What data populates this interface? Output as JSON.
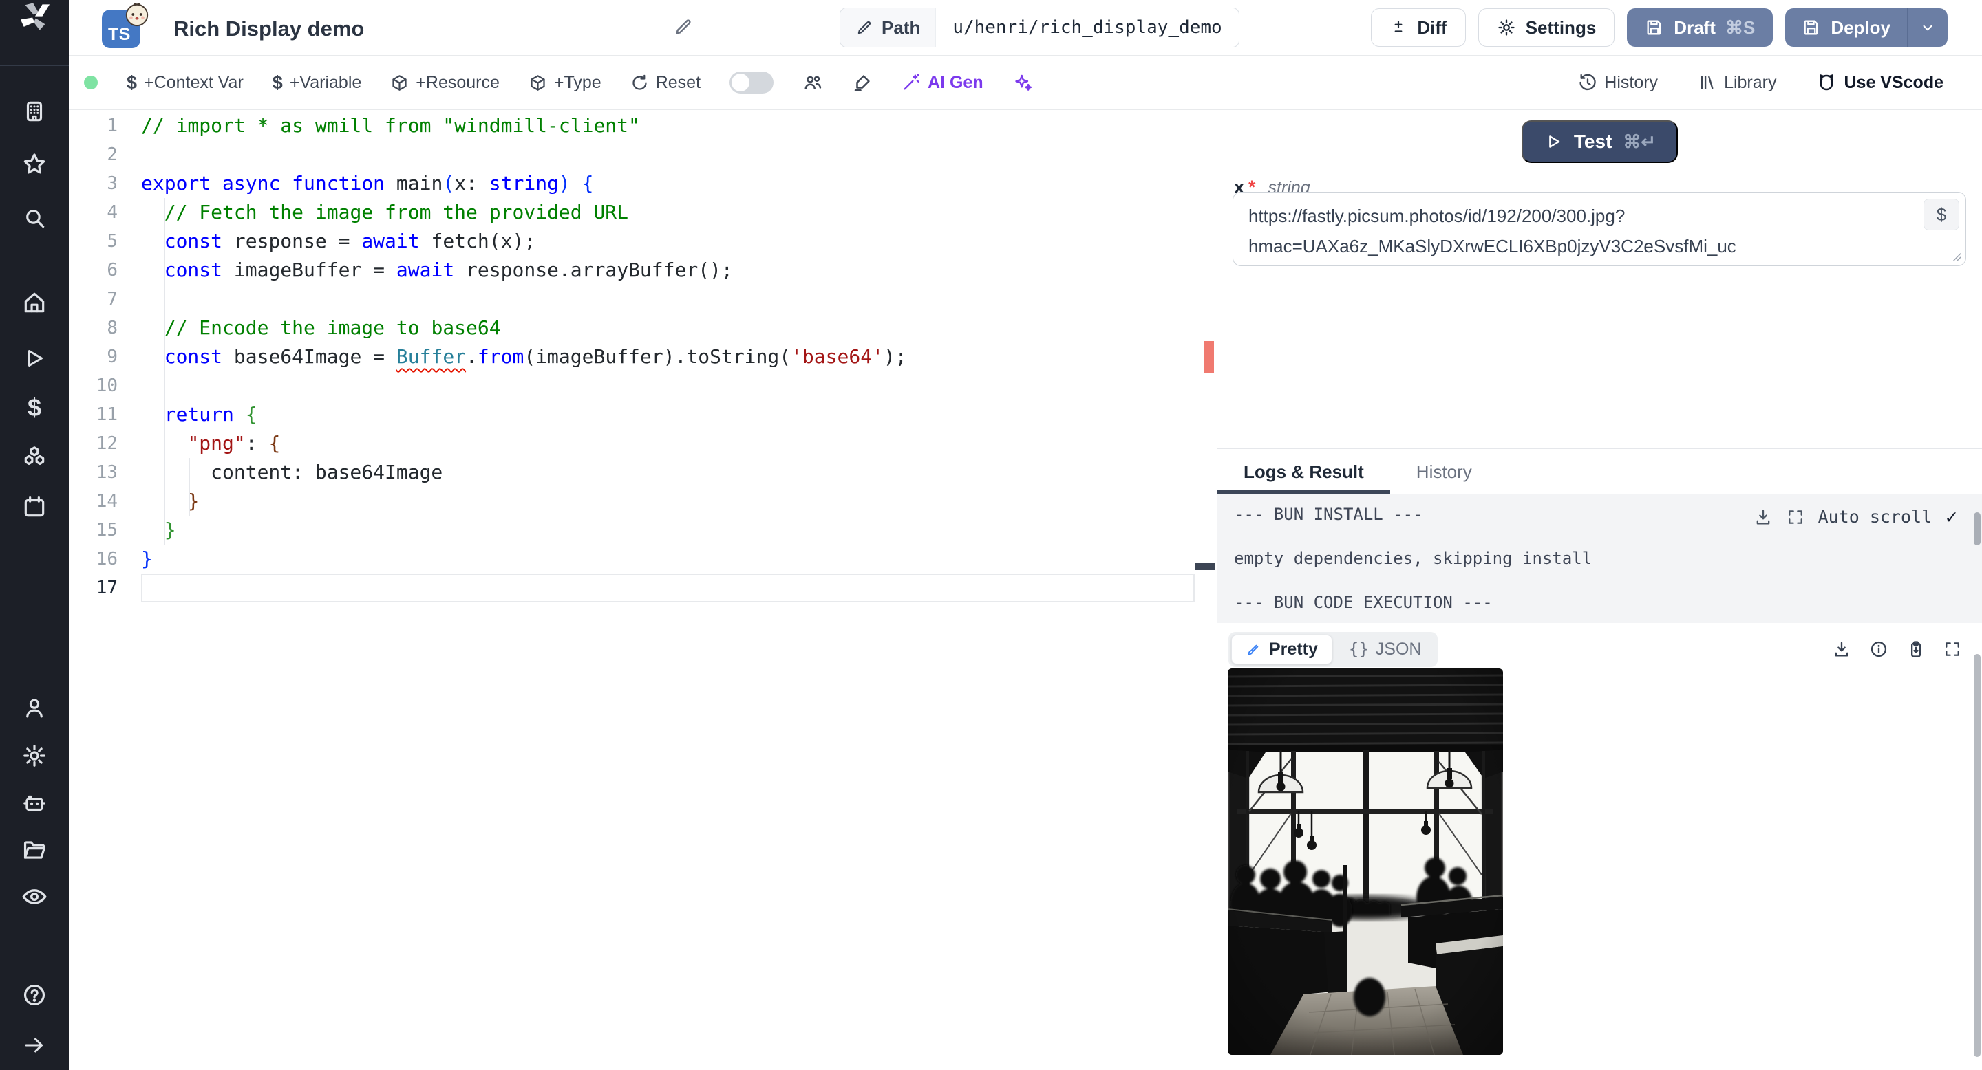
{
  "app": {
    "title": "Rich Display demo",
    "lang_badge": "TS"
  },
  "header": {
    "path_label": "Path",
    "path_value": "u/henri/rich_display_demo",
    "diff": "Diff",
    "settings": "Settings",
    "draft": "Draft",
    "draft_shortcut": "⌘S",
    "deploy": "Deploy"
  },
  "toolbar": {
    "context_var": "+Context Var",
    "variable": "+Variable",
    "resource": "+Resource",
    "type": "+Type",
    "reset": "Reset",
    "ai_gen": "AI Gen",
    "history": "History",
    "library": "Library",
    "vscode": "Use VScode"
  },
  "icons": {
    "dollar": "$",
    "braces": "{}"
  },
  "editor": {
    "lines": [
      {
        "n": 1,
        "tokens": [
          [
            "com",
            "// import * as wmill from \"windmill-client\""
          ]
        ]
      },
      {
        "n": 2,
        "tokens": []
      },
      {
        "n": 3,
        "tokens": [
          [
            "kw",
            "export"
          ],
          [
            "",
            " "
          ],
          [
            "kw",
            "async"
          ],
          [
            "",
            " "
          ],
          [
            "kw",
            "function"
          ],
          [
            "",
            " main"
          ],
          [
            "b1",
            "("
          ],
          [
            "",
            "x: "
          ],
          [
            "kw",
            "string"
          ],
          [
            "b1",
            ")"
          ],
          [
            "",
            " "
          ],
          [
            "b1",
            "{"
          ]
        ]
      },
      {
        "n": 4,
        "tokens": [
          [
            "",
            "  "
          ],
          [
            "com",
            "// Fetch the image from the provided URL"
          ]
        ]
      },
      {
        "n": 5,
        "tokens": [
          [
            "",
            "  "
          ],
          [
            "kw",
            "const"
          ],
          [
            "",
            " response = "
          ],
          [
            "kw",
            "await"
          ],
          [
            "",
            " fetch(x);"
          ]
        ]
      },
      {
        "n": 6,
        "tokens": [
          [
            "",
            "  "
          ],
          [
            "kw",
            "const"
          ],
          [
            "",
            " imageBuffer = "
          ],
          [
            "kw",
            "await"
          ],
          [
            "",
            " response.arrayBuffer();"
          ]
        ]
      },
      {
        "n": 7,
        "tokens": []
      },
      {
        "n": 8,
        "tokens": [
          [
            "",
            "  "
          ],
          [
            "com",
            "// Encode the image to base64"
          ]
        ]
      },
      {
        "n": 9,
        "tokens": [
          [
            "",
            "  "
          ],
          [
            "kw",
            "const"
          ],
          [
            "",
            " base64Image = "
          ],
          [
            "buf",
            "Buffer"
          ],
          [
            "",
            "."
          ],
          [
            "kw",
            "from"
          ],
          [
            "",
            "(imageBuffer).toString("
          ],
          [
            "str",
            "'base64'"
          ],
          [
            "",
            ");"
          ]
        ]
      },
      {
        "n": 10,
        "tokens": []
      },
      {
        "n": 11,
        "tokens": [
          [
            "",
            "  "
          ],
          [
            "kw",
            "return"
          ],
          [
            "",
            " "
          ],
          [
            "b2",
            "{"
          ]
        ]
      },
      {
        "n": 12,
        "tokens": [
          [
            "",
            "    "
          ],
          [
            "str",
            "\"png\""
          ],
          [
            "",
            ": "
          ],
          [
            "b3",
            "{"
          ]
        ]
      },
      {
        "n": 13,
        "tokens": [
          [
            "",
            "      content: base64Image"
          ]
        ]
      },
      {
        "n": 14,
        "tokens": [
          [
            "",
            "    "
          ],
          [
            "b3",
            "}"
          ]
        ]
      },
      {
        "n": 15,
        "tokens": [
          [
            "",
            "  "
          ],
          [
            "b2",
            "}"
          ]
        ]
      },
      {
        "n": 16,
        "tokens": [
          [
            "b1",
            "}"
          ]
        ]
      },
      {
        "n": 17,
        "tokens": [],
        "current": true
      }
    ]
  },
  "panel": {
    "test_label": "Test",
    "test_shortcut": "⌘↵",
    "arg_name": "x",
    "arg_required": "*",
    "arg_type": "string",
    "arg_value": "https://fastly.picsum.photos/id/192/200/300.jpg?hmac=UAXa6z_MKaSlyDXrwECLI6XBp0jzyV3C2eSvsfMi_uc",
    "tab_logs": "Logs & Result",
    "tab_history": "History",
    "logs": [
      "--- BUN INSTALL ---",
      "empty dependencies, skipping install",
      "--- BUN CODE EXECUTION ---"
    ],
    "auto_scroll": "Auto scroll",
    "check": "✓",
    "pretty": "Pretty",
    "json": "JSON"
  }
}
